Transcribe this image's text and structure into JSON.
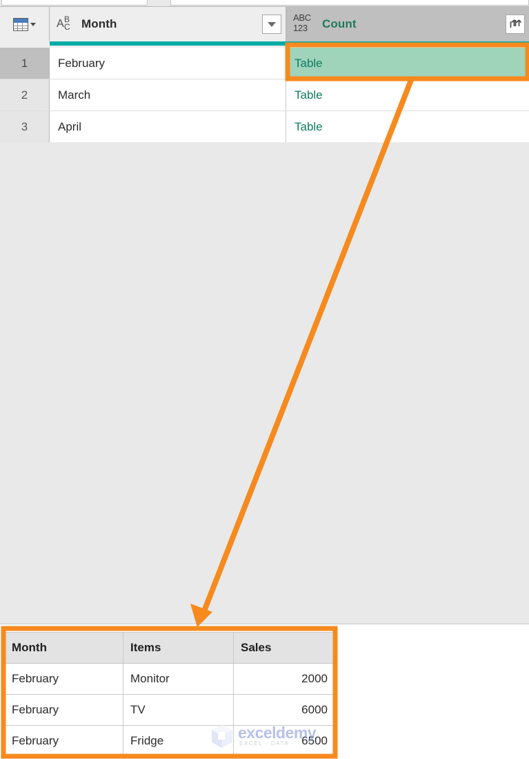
{
  "app": {
    "accent_orange": "#f68a1e",
    "teal_quality": "#00ada6",
    "selection_green": "#9fd4bb",
    "header_gray": "#bfbfbf"
  },
  "top_strip": {
    "left_box_name": "formula-bar-left-remnant",
    "right_box_name": "formula-bar-right-remnant"
  },
  "grid": {
    "table_chooser_icon": "table-grid-icon",
    "columns": [
      {
        "name": "Month",
        "type_icon": "abc-text-type-icon",
        "type_icon_text": "ABC",
        "header_color": "#2b2b2b",
        "has_filter_button": true,
        "filter_icon": "chevron-down-icon"
      },
      {
        "name": "Count",
        "type_icon": "abc123-any-type-icon",
        "type_icon_line1": "ABC",
        "type_icon_line2": "123",
        "header_color": "#1f7a5c",
        "has_expand_button": true,
        "expand_icon": "expand-columns-icon"
      }
    ],
    "rows": [
      {
        "num": "1",
        "month": "February",
        "count": "Table",
        "selected": true
      },
      {
        "num": "2",
        "month": "March",
        "count": "Table",
        "selected": false
      },
      {
        "num": "3",
        "month": "April",
        "count": "Table",
        "selected": false
      }
    ]
  },
  "annotation": {
    "highlight_box_name": "orange-highlight-table-cell",
    "arrow_name": "orange-pointer-arrow",
    "result_box_name": "orange-highlight-result-table"
  },
  "result_table": {
    "headers": [
      "Month",
      "Items",
      "Sales"
    ],
    "rows": [
      {
        "month": "February",
        "items": "Monitor",
        "sales": "2000"
      },
      {
        "month": "February",
        "items": "TV",
        "sales": "6000"
      },
      {
        "month": "February",
        "items": "Fridge",
        "sales": "6500"
      }
    ]
  },
  "watermark": {
    "brand": "exceldemy",
    "tagline": "EXCEL - DATA -"
  }
}
